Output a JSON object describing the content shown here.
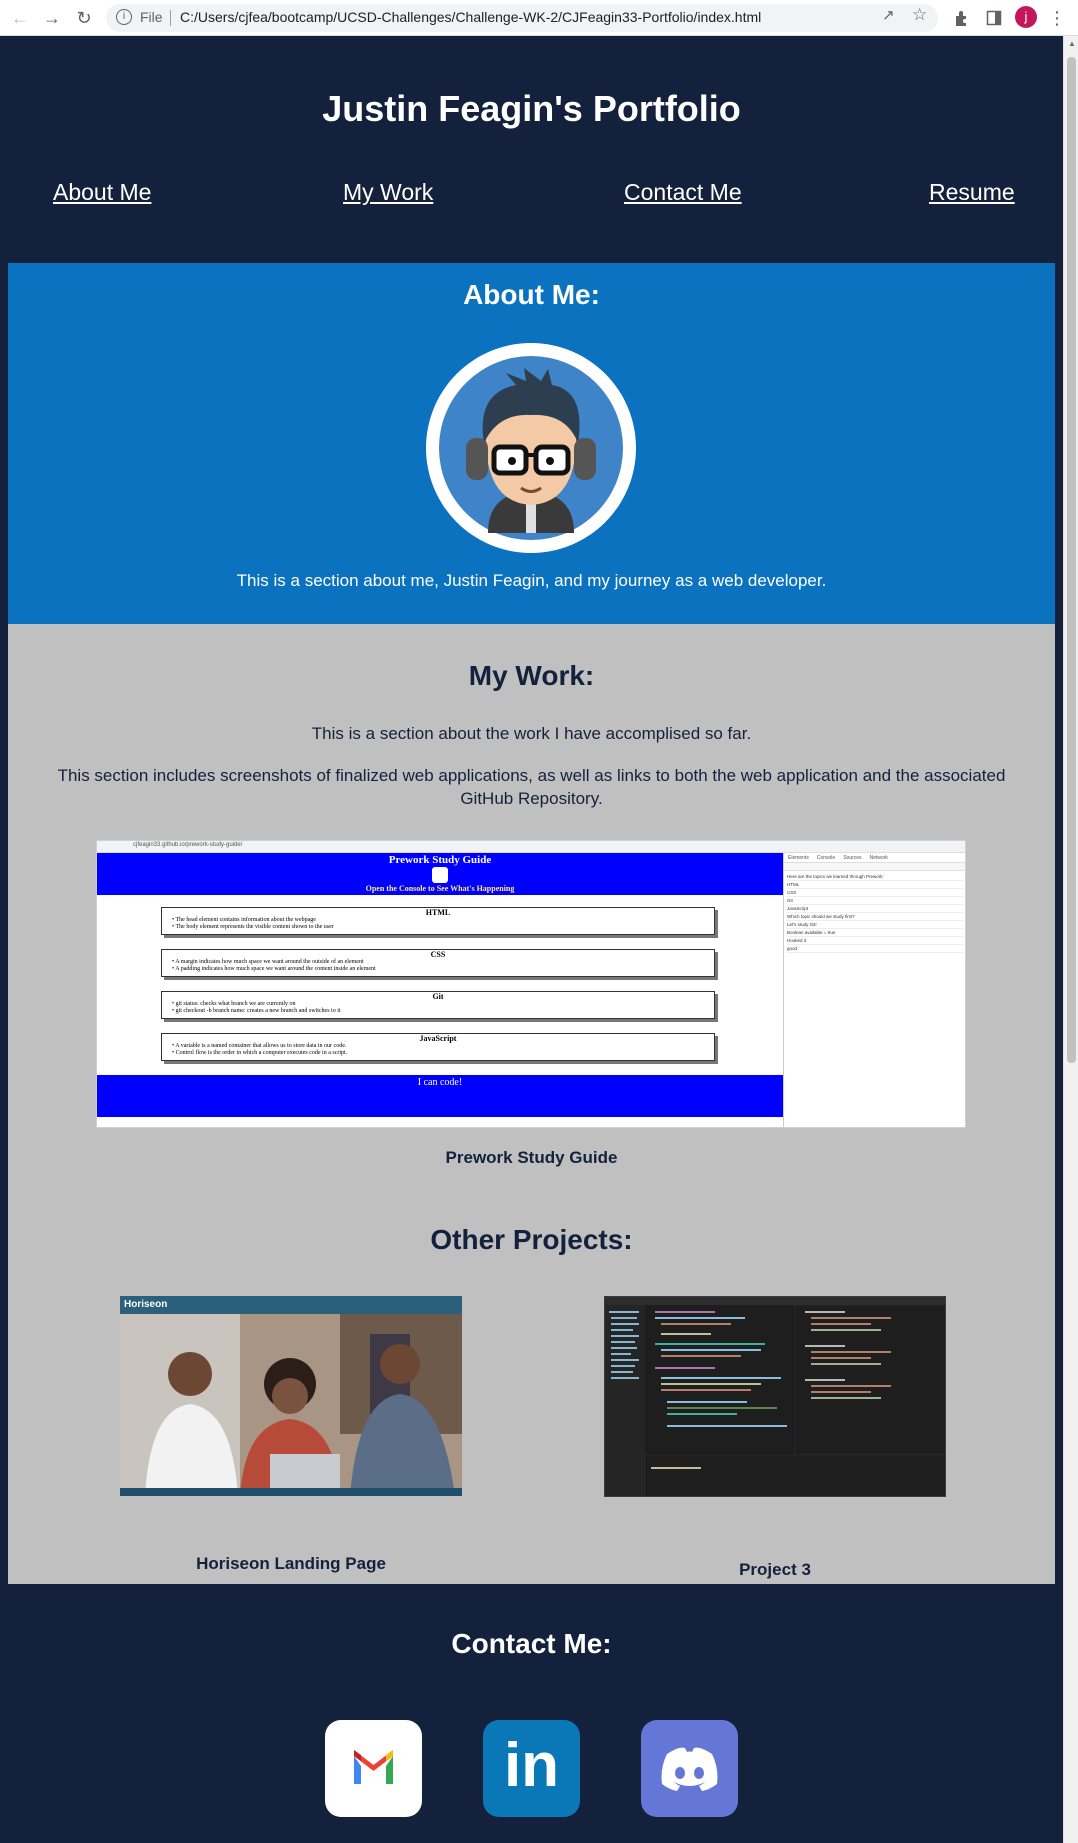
{
  "browser": {
    "file_label": "File",
    "url": "C:/Users/cjfea/bootcamp/UCSD-Challenges/Challenge-WK-2/CJFeagin33-Portfolio/index.html",
    "profile_initial": "j"
  },
  "site": {
    "title": "Justin Feagin's Portfolio"
  },
  "nav": {
    "about": "About Me",
    "work": "My Work",
    "contact": "Contact Me",
    "resume": "Resume"
  },
  "about": {
    "title": "About Me:",
    "text": "This is a section about me, Justin Feagin, and my journey as a web developer."
  },
  "work": {
    "title": "My Work:",
    "intro": "This is a section about the work I have accomplised so far.",
    "detail": "This section includes screenshots of finalized web applications, as well as links to both the web application and the associated GitHub Repository.",
    "featured": {
      "caption": "Prework Study Guide",
      "shot": {
        "url": "cjfeagin33.github.io/prework-study-guide/",
        "title": "Prework Study Guide",
        "console_note": "Open the Console to See What's Happening",
        "cards": [
          {
            "heading": "HTML",
            "lines": [
              "The head element contains information about the webpage",
              "The body element represents the visible content shown to the user"
            ]
          },
          {
            "heading": "CSS",
            "lines": [
              "A margin indicates how much space we want around the outside of an element",
              "A padding indicates how much space we want around the content inside an element"
            ]
          },
          {
            "heading": "Git",
            "lines": [
              "git status: checks what branch we are currently on",
              "git checkout -b branch name: creates a new branch and switches to it"
            ]
          },
          {
            "heading": "JavaScript",
            "lines": [
              "A variable is a named container that allows us to store data in our code.",
              "Control flow is the order in which a computer executes code in a script."
            ]
          }
        ],
        "footer": "I can code!",
        "devtools_tabs": [
          "Elements",
          "Console",
          "Sources",
          "Network"
        ],
        "console_lines": [
          "Here are the topics we learned through Prework:",
          "HTML",
          "CSS",
          "Git",
          "JavaScript",
          "Which topic should we study first?",
          "Let's study Git!",
          "Boolean available = true",
          "Hooked it",
          "good"
        ]
      }
    },
    "other_title": "Other Projects:",
    "projects": [
      {
        "caption": "Horiseon Landing Page",
        "header": "Horiseon"
      },
      {
        "caption": "Project 3"
      }
    ]
  },
  "contact": {
    "title": "Contact Me:",
    "links": [
      {
        "icon": "gmail-icon",
        "color": "#ffffff"
      },
      {
        "icon": "linkedin-icon",
        "color": "#0a78b6",
        "label": "in"
      },
      {
        "icon": "discord-icon",
        "color": "#6577d6"
      }
    ]
  },
  "colors": {
    "navy": "#14213d",
    "blue": "#0a72bf",
    "gray": "#c0c0c0"
  }
}
